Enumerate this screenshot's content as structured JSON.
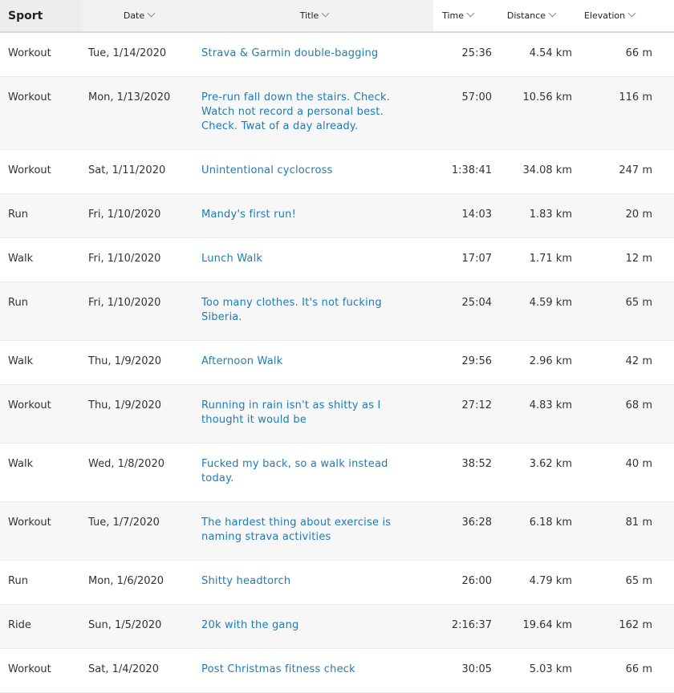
{
  "columns": {
    "sport": "Sport",
    "date": "Date",
    "title": "Title",
    "time": "Time",
    "distance": "Distance",
    "elevation": "Elevation"
  },
  "sort_icon": "chevron-down-icon",
  "colors": {
    "link": "#1f7bb6",
    "stripe": "#f7f7f7",
    "text": "#333333"
  },
  "activities": [
    {
      "sport": "Workout",
      "date": "Tue, 1/14/2020",
      "title": "Strava & Garmin double-bagging",
      "time": "25:36",
      "distance": "4.54 km",
      "elevation": "66 m"
    },
    {
      "sport": "Workout",
      "date": "Mon, 1/13/2020",
      "title": "Pre-run fall down the stairs. Check. Watch not record a personal best. Check. Twat of a day already.",
      "time": "57:00",
      "distance": "10.56 km",
      "elevation": "116 m"
    },
    {
      "sport": "Workout",
      "date": "Sat, 1/11/2020",
      "title": "Unintentional cyclocross",
      "time": "1:38:41",
      "distance": "34.08 km",
      "elevation": "247 m"
    },
    {
      "sport": "Run",
      "date": "Fri, 1/10/2020",
      "title": "Mandy's first run!",
      "time": "14:03",
      "distance": "1.83 km",
      "elevation": "20 m"
    },
    {
      "sport": "Walk",
      "date": "Fri, 1/10/2020",
      "title": "Lunch Walk",
      "time": "17:07",
      "distance": "1.71 km",
      "elevation": "12 m"
    },
    {
      "sport": "Run",
      "date": "Fri, 1/10/2020",
      "title": "Too many clothes. It's not fucking Siberia.",
      "time": "25:04",
      "distance": "4.59 km",
      "elevation": "65 m"
    },
    {
      "sport": "Walk",
      "date": "Thu, 1/9/2020",
      "title": "Afternoon Walk",
      "time": "29:56",
      "distance": "2.96 km",
      "elevation": "42 m"
    },
    {
      "sport": "Workout",
      "date": "Thu, 1/9/2020",
      "title": "Running in rain isn't as shitty as I thought it would be",
      "time": "27:12",
      "distance": "4.83 km",
      "elevation": "68 m"
    },
    {
      "sport": "Walk",
      "date": "Wed, 1/8/2020",
      "title": "Fucked my back, so a walk instead today.",
      "time": "38:52",
      "distance": "3.62 km",
      "elevation": "40 m"
    },
    {
      "sport": "Workout",
      "date": "Tue, 1/7/2020",
      "title": "The hardest thing about exercise is naming strava activities",
      "time": "36:28",
      "distance": "6.18 km",
      "elevation": "81 m"
    },
    {
      "sport": "Run",
      "date": "Mon, 1/6/2020",
      "title": "Shitty headtorch",
      "time": "26:00",
      "distance": "4.79 km",
      "elevation": "65 m"
    },
    {
      "sport": "Ride",
      "date": "Sun, 1/5/2020",
      "title": "20k with the gang",
      "time": "2:16:37",
      "distance": "19.64 km",
      "elevation": "162 m"
    },
    {
      "sport": "Workout",
      "date": "Sat, 1/4/2020",
      "title": "Post Christmas fitness check",
      "time": "30:05",
      "distance": "5.03 km",
      "elevation": "66 m"
    }
  ]
}
